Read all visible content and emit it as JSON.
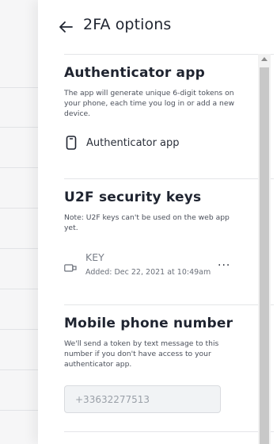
{
  "header": {
    "title": "2FA options",
    "back_icon": "arrow-left-icon"
  },
  "authenticator": {
    "title": "Authenticator app",
    "description": "The app will generate unique 6-digit tokens on your phone, each time you log in or add a new device.",
    "item_label": "Authenticator app",
    "item_icon": "phone-icon"
  },
  "u2f": {
    "title": "U2F security keys",
    "note": "Note: U2F keys can't be used on the web app yet.",
    "key": {
      "name": "KEY",
      "added": "Added: Dec 22, 2021 at 10:49am",
      "icon": "security-key-icon",
      "more_icon": "more-horizontal-icon"
    }
  },
  "mobile": {
    "title": "Mobile phone number",
    "description": "We'll send a token by text message to this number if you don't have access to your authenticator app.",
    "phone_value": "+33632277513"
  }
}
